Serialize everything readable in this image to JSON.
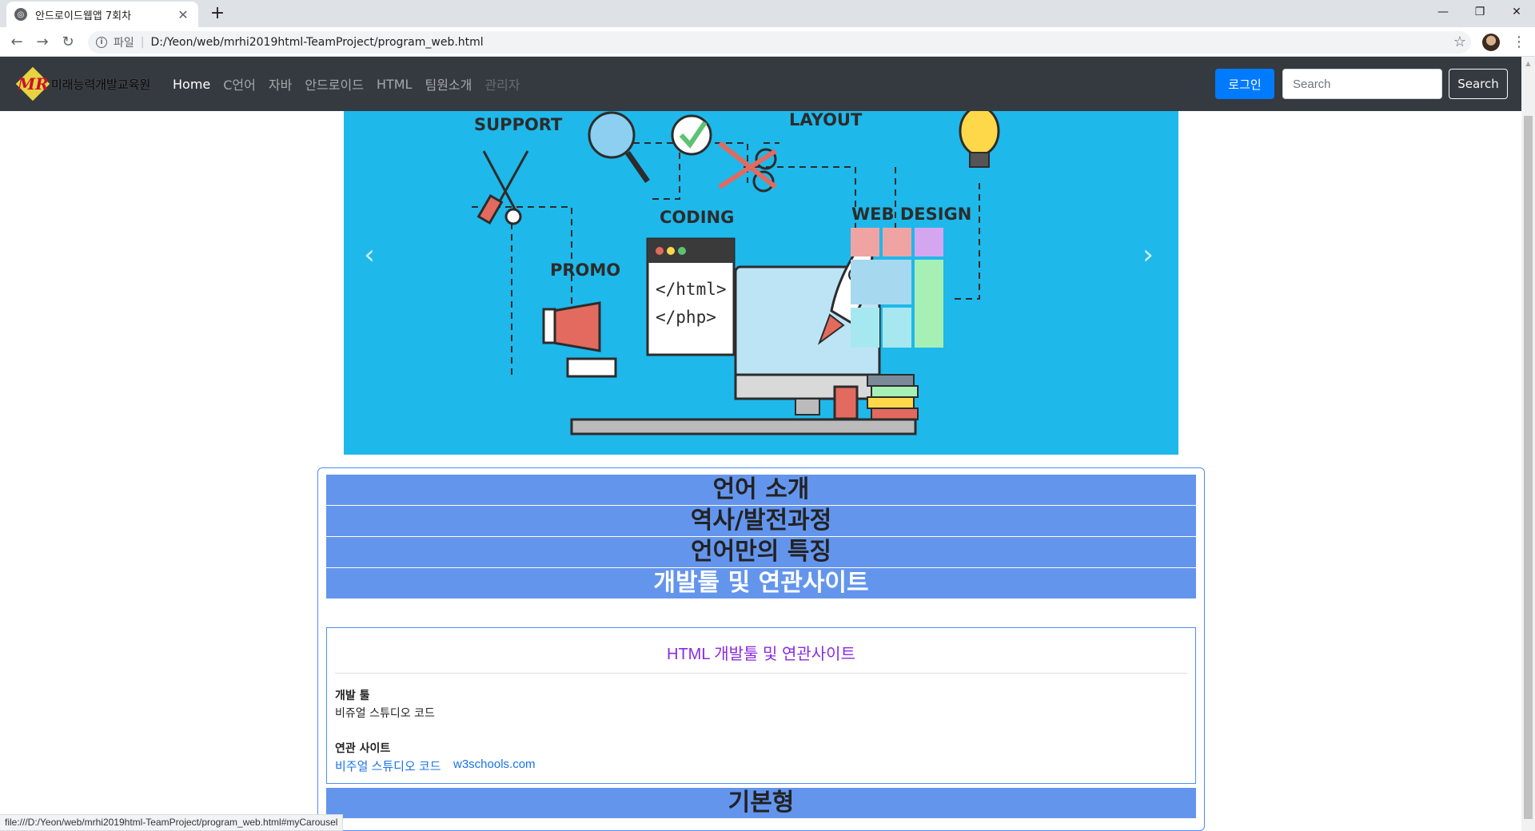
{
  "browser": {
    "tab_title": "안드로이드웹앱 7회차",
    "tab_close": "✕",
    "new_tab": "+",
    "win_minimize": "—",
    "win_restore": "❐",
    "win_close": "✕",
    "back": "←",
    "forward": "→",
    "reload": "↻",
    "scheme_label": "파일",
    "separator": "|",
    "url": "D:/Yeon/web/mrhi2019html-TeamProject/program_web.html",
    "star": "☆",
    "menu": "⋮",
    "status_url": "file:///D:/Yeon/web/mrhi2019html-TeamProject/program_web.html#myCarousel"
  },
  "navbar": {
    "brand_logo_text": "MR",
    "brand_text": "미래능력개발교육원",
    "links": [
      {
        "label": "Home",
        "state": "active"
      },
      {
        "label": "C언어",
        "state": "normal"
      },
      {
        "label": "자바",
        "state": "normal"
      },
      {
        "label": "안드로이드",
        "state": "normal"
      },
      {
        "label": "HTML",
        "state": "normal"
      },
      {
        "label": "팀원소개",
        "state": "normal"
      },
      {
        "label": "관리자",
        "state": "disabled"
      }
    ],
    "login_label": "로그인",
    "search_placeholder": "Search",
    "search_button": "Search"
  },
  "carousel": {
    "prev": "‹",
    "next": "›",
    "labels": {
      "support": "SUPPORT",
      "layout": "LAYOUT",
      "coding": "CODING",
      "web_design": "WEB DESIGN",
      "promo": "PROMO",
      "code_line1": "</html>",
      "code_line2": "</php>"
    },
    "colors": {
      "background": "#1fb8ea"
    }
  },
  "accordion": {
    "headers": [
      "언어 소개",
      "역사/발전과정",
      "언어만의 특징",
      "개발툴 및 연관사이트",
      "기본형"
    ],
    "header_color": "#6495ed",
    "panel": {
      "title": "HTML 개발툴 및 연관사이트",
      "tool_label": "개발 툴",
      "tool_value": "비쥬얼 스튜디오 코드",
      "site_label": "연관 사이트",
      "links": [
        "비주얼 스튜디오 코드",
        "w3schools.com"
      ]
    }
  }
}
